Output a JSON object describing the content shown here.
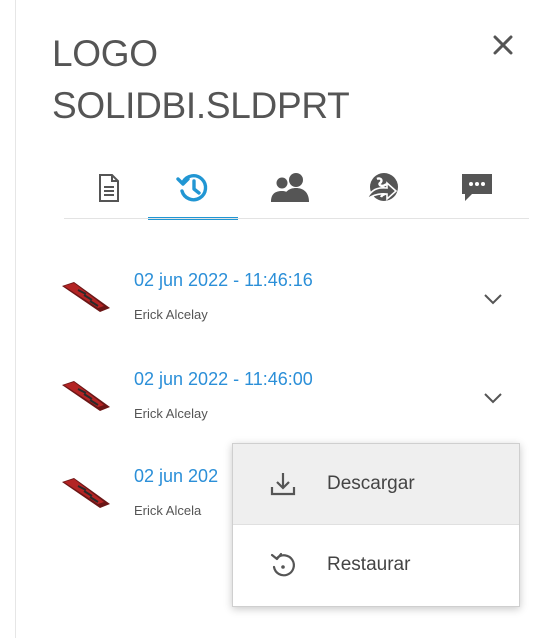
{
  "panel": {
    "title_line1": "LOGO",
    "title_line2": "SOLIDBI.SLDPRT",
    "close_icon": "close-icon"
  },
  "tabs": [
    {
      "name": "document",
      "icon": "document-icon",
      "active": false
    },
    {
      "name": "history",
      "icon": "history-icon",
      "active": true
    },
    {
      "name": "users",
      "icon": "users-icon",
      "active": false
    },
    {
      "name": "share",
      "icon": "globe-share-icon",
      "active": false
    },
    {
      "name": "comments",
      "icon": "comment-icon",
      "active": false
    }
  ],
  "versions": [
    {
      "date": "02 jun 2022 - 11:46:16",
      "user": "Erick Alcelay"
    },
    {
      "date": "02 jun 2022 - 11:46:00",
      "user": "Erick Alcelay"
    },
    {
      "date": "02 jun 202",
      "user": "Erick Alcela"
    }
  ],
  "context_menu": {
    "download_label": "Descargar",
    "restore_label": "Restaurar"
  },
  "colors": {
    "accent": "#2196d3",
    "link": "#2b8fd8",
    "icon": "#555555"
  }
}
